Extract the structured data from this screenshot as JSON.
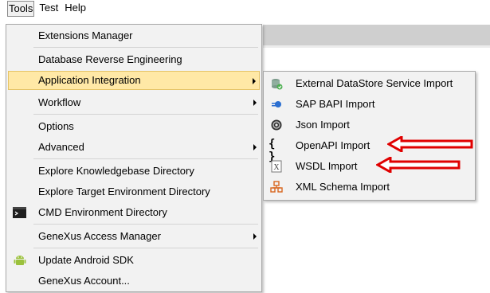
{
  "menubar": {
    "items": [
      {
        "label": "Tools"
      },
      {
        "label": "Test"
      },
      {
        "label": "Help"
      }
    ]
  },
  "tools_menu": {
    "items": [
      {
        "label": "Extensions Manager"
      },
      {
        "label": "Database Reverse Engineering"
      },
      {
        "label": "Application Integration"
      },
      {
        "label": "Workflow"
      },
      {
        "label": "Options"
      },
      {
        "label": "Advanced"
      },
      {
        "label": "Explore Knowledgebase Directory"
      },
      {
        "label": "Explore Target Environment Directory"
      },
      {
        "label": "CMD Environment Directory",
        "icon": "terminal-icon"
      },
      {
        "label": "GeneXus Access Manager"
      },
      {
        "label": "Update Android SDK",
        "icon": "android-icon"
      },
      {
        "label": "GeneXus Account..."
      }
    ]
  },
  "integration_submenu": {
    "items": [
      {
        "label": "External DataStore Service Import",
        "icon": "datastore-icon"
      },
      {
        "label": "SAP BAPI Import",
        "icon": "sap-icon"
      },
      {
        "label": "Json Import",
        "icon": "json-icon"
      },
      {
        "label": "OpenAPI Import",
        "icon": "curly-braces-icon"
      },
      {
        "label": "WSDL Import",
        "icon": "wsdl-icon"
      },
      {
        "label": "XML Schema Import",
        "icon": "xml-schema-icon"
      }
    ]
  },
  "colors": {
    "highlight": "#ffe8a6",
    "menu_bg": "#f2f2f2",
    "annotation_arrow": "#e00000"
  }
}
